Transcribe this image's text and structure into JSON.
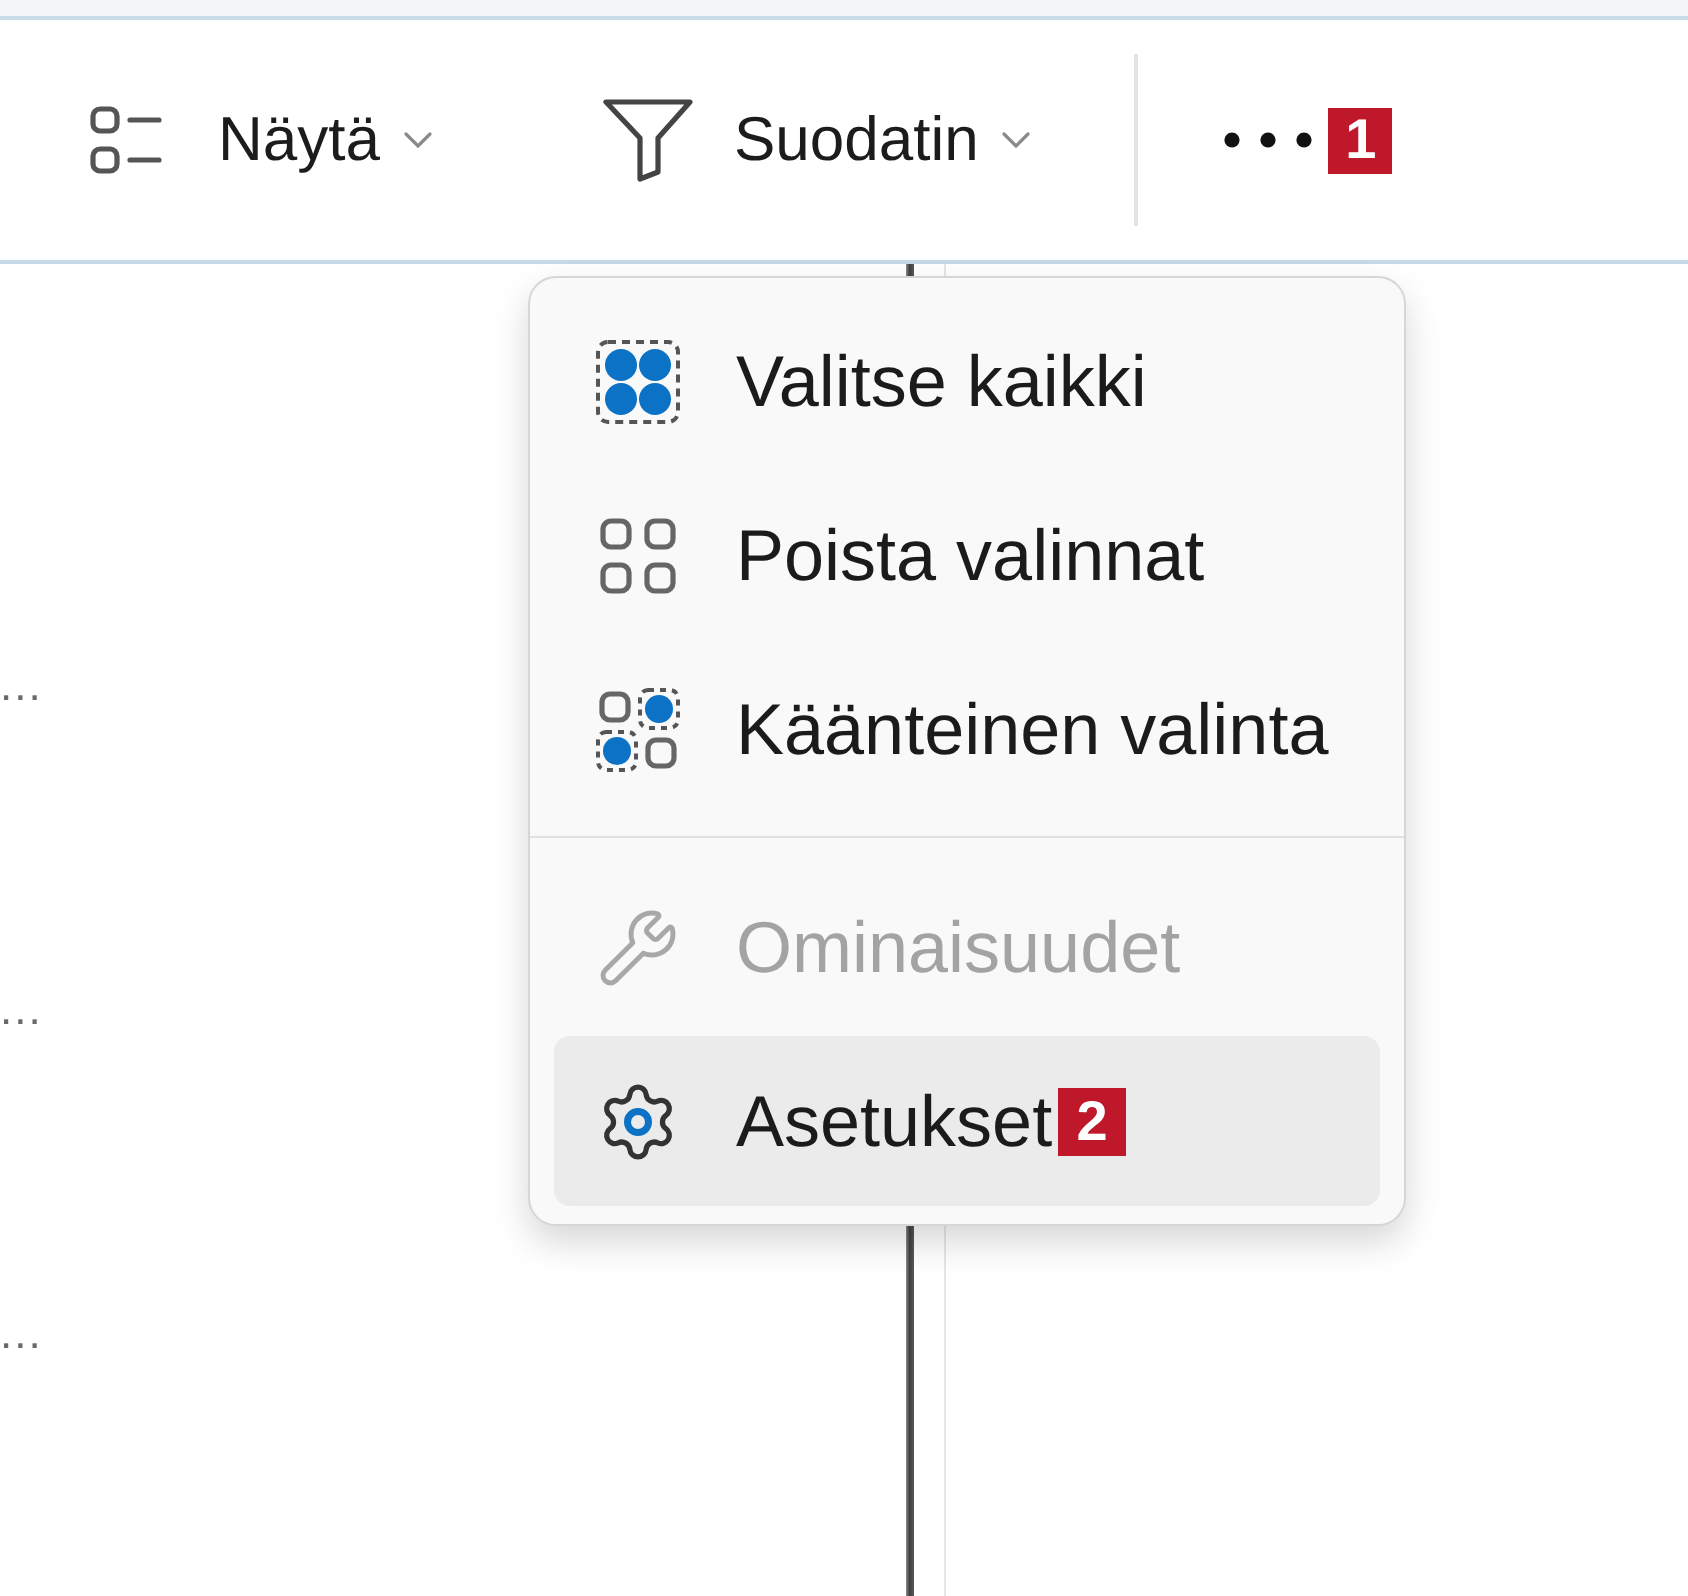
{
  "toolbar": {
    "dropdowns": [
      {
        "label": "Näytä"
      },
      {
        "label": "Suodatin"
      }
    ],
    "more_button": {
      "callout": "1"
    }
  },
  "menu": {
    "groups": [
      {
        "items": [
          {
            "label": "Valitse kaikki",
            "disabled": false,
            "highlighted": false
          },
          {
            "label": "Poista valinnat",
            "disabled": false,
            "highlighted": false
          },
          {
            "label": "Käänteinen valinta",
            "disabled": false,
            "highlighted": false
          }
        ]
      },
      {
        "items": [
          {
            "label": "Ominaisuudet",
            "disabled": true,
            "highlighted": false
          },
          {
            "label": "Asetukset",
            "disabled": false,
            "highlighted": true,
            "callout": "2"
          }
        ]
      }
    ]
  },
  "file_list": {
    "rows": [
      "...",
      "...",
      "..."
    ]
  }
}
